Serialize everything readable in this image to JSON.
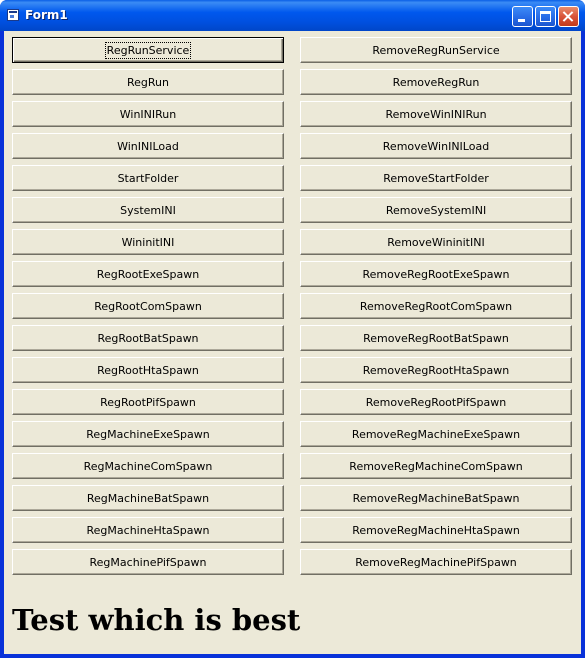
{
  "window": {
    "title": "Form1"
  },
  "titlebar_buttons": {
    "minimize": "minimize",
    "maximize": "maximize",
    "close": "close"
  },
  "buttons": [
    {
      "left": "RegRunService",
      "right": "RemoveRegRunService"
    },
    {
      "left": "RegRun",
      "right": "RemoveRegRun"
    },
    {
      "left": "WinINIRun",
      "right": "RemoveWinINIRun"
    },
    {
      "left": "WinINILoad",
      "right": "RemoveWinINILoad"
    },
    {
      "left": "StartFolder",
      "right": "RemoveStartFolder"
    },
    {
      "left": "SystemINI",
      "right": "RemoveSystemINI"
    },
    {
      "left": "WininitINI",
      "right": "RemoveWininitINI"
    },
    {
      "left": "RegRootExeSpawn",
      "right": "RemoveRegRootExeSpawn"
    },
    {
      "left": "RegRootComSpawn",
      "right": "RemoveRegRootComSpawn"
    },
    {
      "left": "RegRootBatSpawn",
      "right": "RemoveRegRootBatSpawn"
    },
    {
      "left": "RegRootHtaSpawn",
      "right": "RemoveRegRootHtaSpawn"
    },
    {
      "left": "RegRootPifSpawn",
      "right": "RemoveRegRootPifSpawn"
    },
    {
      "left": "RegMachineExeSpawn",
      "right": "RemoveRegMachineExeSpawn"
    },
    {
      "left": "RegMachineComSpawn",
      "right": "RemoveRegMachineComSpawn"
    },
    {
      "left": "RegMachineBatSpawn",
      "right": "RemoveRegMachineBatSpawn"
    },
    {
      "left": "RegMachineHtaSpawn",
      "right": "RemoveRegMachineHtaSpawn"
    },
    {
      "left": "RegMachinePifSpawn",
      "right": "RemoveRegMachinePifSpawn"
    }
  ],
  "caption": "Test which is best",
  "colors": {
    "titlebar": "#0058ee",
    "client": "#ece9d8",
    "close_button": "#d9543a"
  }
}
